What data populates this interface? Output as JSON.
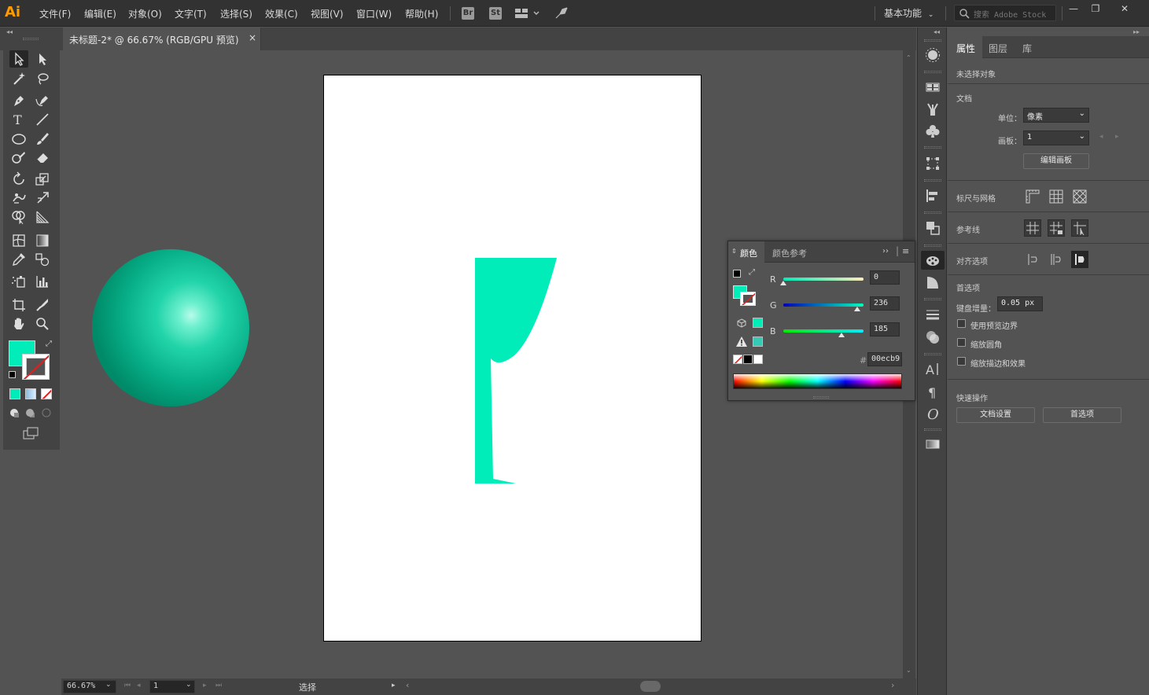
{
  "app": {
    "logo": "Ai",
    "workspace": "基本功能",
    "stock_search_placeholder": "搜索 Adobe Stock"
  },
  "menu": [
    "文件(F)",
    "编辑(E)",
    "对象(O)",
    "文字(T)",
    "选择(S)",
    "效果(C)",
    "视图(V)",
    "窗口(W)",
    "帮助(H)"
  ],
  "menu_badges": {
    "bridge": "Br",
    "stock": "St"
  },
  "window_controls": {
    "minimize": "—",
    "restore": "❐",
    "close": "✕"
  },
  "document_tab": {
    "title": "未标题-2* @ 66.67% (RGB/GPU 预览)",
    "close": "×"
  },
  "status_bar": {
    "zoom": "66.67%",
    "artboard": "1",
    "tool": "选择"
  },
  "color_panel": {
    "tab_color": "颜色",
    "tab_guide": "颜色参考",
    "r_label": "R",
    "g_label": "G",
    "b_label": "B",
    "r": "0",
    "g": "236",
    "b": "185",
    "hex_label": "#",
    "hex": "00ecb9",
    "fill_color": "#00ecb9"
  },
  "properties": {
    "tabs": [
      "属性",
      "图层",
      "库"
    ],
    "no_selection": "未选择对象",
    "document_title": "文档",
    "unit_label": "单位：",
    "unit_value": "像素",
    "artboard_label": "画板：",
    "artboard_value": "1",
    "edit_artboards": "编辑画板",
    "rulers_grids": "标尺与网格",
    "guides": "参考线",
    "snap_options": "对齐选项",
    "preferences_title": "首选项",
    "keyboard_increment_label": "键盘增量：",
    "keyboard_increment_value": "0.05 px",
    "check_preview_bounds": "使用预览边界",
    "check_scale_corners": "缩放圆角",
    "check_scale_strokes": "缩放描边和效果",
    "quick_actions": "快速操作",
    "doc_setup": "文档设置",
    "preferences_button": "首选项"
  },
  "artwork": {
    "fill": "#00ecb9",
    "sphere_highlight": "#8ff5dc",
    "sphere_shadow": "#008f6c"
  }
}
